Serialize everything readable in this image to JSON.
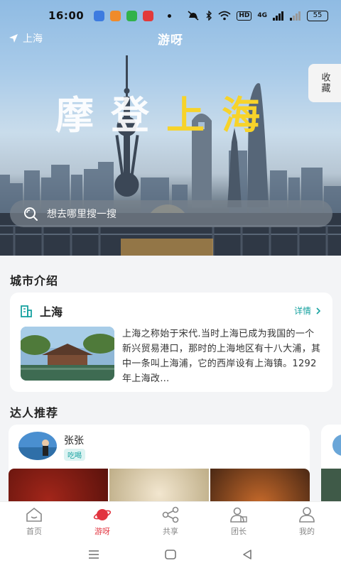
{
  "status_bar": {
    "time": "16:00",
    "hd_label": "HD",
    "network": "4G",
    "battery": "55"
  },
  "header": {
    "location": "上海",
    "app_title": "游呀",
    "collect_label": "收藏"
  },
  "hero": {
    "slogan_white": "摩登",
    "slogan_yellow": "上海"
  },
  "search": {
    "placeholder": "想去哪里搜一搜"
  },
  "city_intro": {
    "section_title": "城市介绍",
    "city_name": "上海",
    "more_label": "详情",
    "description": "上海之称始于宋代.当时上海已成为我国的一个新兴贸易港口，那时的上海地区有十八大浦，其中一条叫上海浦，它的西岸设有上海镇。1292年上海改…"
  },
  "experts": {
    "section_title": "达人推荐",
    "items": [
      {
        "name": "张张",
        "tag": "吃喝"
      }
    ]
  },
  "tabbar": {
    "items": [
      {
        "label": "首页",
        "icon": "home-icon"
      },
      {
        "label": "游呀",
        "icon": "planet-icon"
      },
      {
        "label": "共享",
        "icon": "share-icon"
      },
      {
        "label": "团长",
        "icon": "leader-icon"
      },
      {
        "label": "我的",
        "icon": "profile-icon"
      }
    ],
    "active_index": 1
  },
  "colors": {
    "accent": "#e2343f",
    "teal": "#17a2a0",
    "slogan_yellow": "#f7d32a"
  }
}
